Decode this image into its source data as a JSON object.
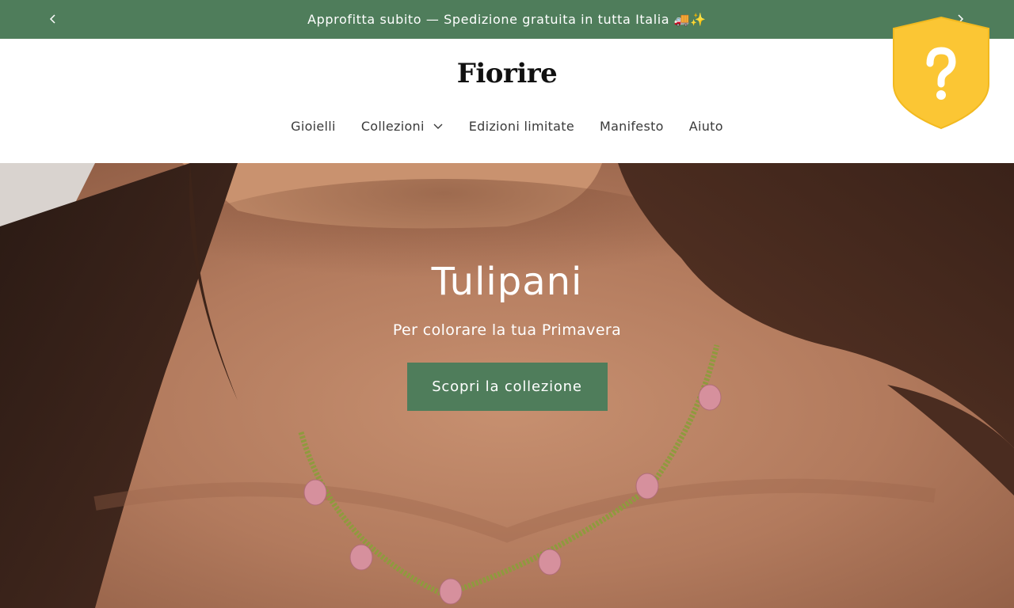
{
  "announcement": {
    "text": "Approfitta subito — Spedizione gratuita in tutta Italia 🚚✨",
    "prev_icon": "chevron-left-icon",
    "next_icon": "chevron-right-icon"
  },
  "header": {
    "logo": "Fiorire",
    "nav": [
      {
        "label": "Gioielli"
      },
      {
        "label": "Collezioni",
        "icon": "chevron-down-icon"
      },
      {
        "label": "Edizioni limitate"
      },
      {
        "label": "Manifesto"
      },
      {
        "label": "Aiuto"
      }
    ],
    "badge_icon": "shield-question-icon"
  },
  "hero": {
    "title": "Tulipani",
    "subtitle": "Per colorare la tua Primavera",
    "cta": "Scopri la collezione"
  },
  "colors": {
    "brand_green": "#4f7d5b",
    "badge_yellow": "#fbc634"
  }
}
